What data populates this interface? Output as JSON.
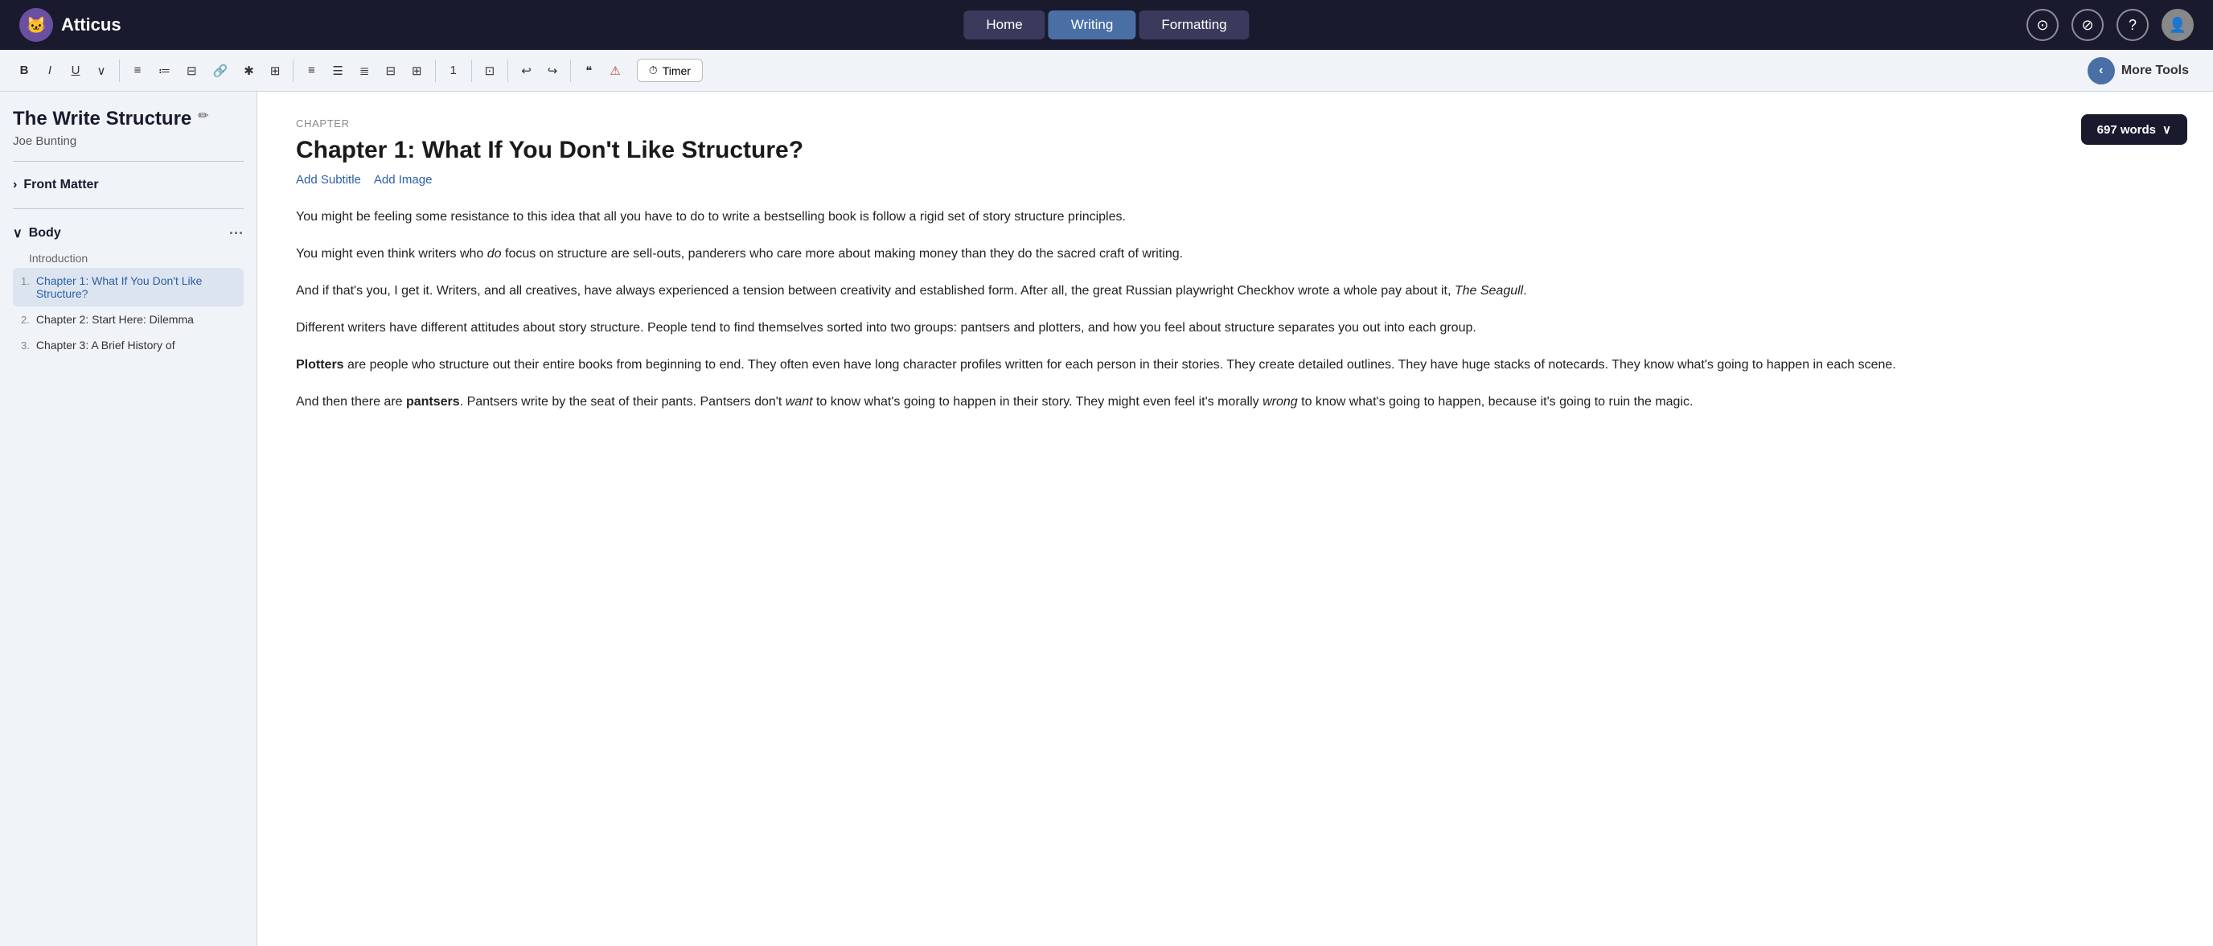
{
  "app": {
    "name": "Atticus",
    "logo_emoji": "🐱"
  },
  "nav": {
    "home_label": "Home",
    "writing_label": "Writing",
    "formatting_label": "Formatting"
  },
  "nav_icons": {
    "export_label": "⊙",
    "save_label": "💾",
    "help_label": "?",
    "avatar_label": "👤"
  },
  "toolbar": {
    "bold": "B",
    "italic": "I",
    "underline": "U",
    "dropdown": "∨",
    "align_left": "≡",
    "bullet_list": "≔",
    "numbered_list": "⊟",
    "link": "🔗",
    "asterisk": "✱",
    "image": "⊞",
    "sep1": "",
    "align_c1": "≡",
    "align_c2": "≡",
    "align_c3": "≡",
    "align_c4": "≡",
    "align_c5": "≡",
    "sep2": "",
    "number_1": "1",
    "sep3": "",
    "expand": "⊡",
    "sep4": "",
    "undo": "↩",
    "redo": "↪",
    "sep5": "",
    "quote": "❝",
    "alert": "⚠",
    "timer_label": "Timer",
    "more_tools_label": "More Tools",
    "chevron_left": "‹"
  },
  "sidebar": {
    "book_title": "The Write Structure",
    "book_author": "Joe Bunting",
    "front_matter_label": "Front Matter",
    "body_label": "Body",
    "intro_label": "Introduction",
    "chapters": [
      {
        "num": "1.",
        "title": "Chapter 1: What If You Don't Like Structure?",
        "active": true
      },
      {
        "num": "2.",
        "title": "Chapter 2: Start Here: Dilemma",
        "active": false
      },
      {
        "num": "3.",
        "title": "Chapter 3: A Brief History of",
        "active": false
      }
    ]
  },
  "editor": {
    "chapter_label": "Chapter",
    "chapter_title": "Chapter 1: What If You Don't Like Structure?",
    "add_subtitle_label": "Add Subtitle",
    "add_image_label": "Add Image",
    "words_count": "697 words",
    "words_chevron": "∨",
    "paragraphs": [
      "You might be feeling some resistance to this idea that all you have to do to write a bestselling book is follow a rigid set of story structure principles.",
      "You might even think writers who {em}do{/em} focus on structure are sell-outs, panderers who care more about making money than they do the sacred craft of writing.",
      "And if that's you, I get it. Writers, and all creatives, have always experienced a tension between creativity and established form. After all, the great Russian playwright Checkhov wrote a whole pay about it, {em}The Seagull{/em}.",
      "Different writers have different attitudes about story structure. People tend to find themselves sorted into two groups: pantsers and plotters, and how you feel about structure separates you out into each group.",
      "{strong}Plotters{/strong} are people who structure out their entire books from beginning to end. They often even have long character profiles written for each person in their stories. They create detailed outlines. They have huge stacks of notecards. They know what's going to happen in each scene.",
      "And then there are {strong}pantsers{/strong}. Pantsers write by the seat of their pants. Pantsers don't {em}want{/em} to know what's going to happen in their story. They might even feel it's morally {em}wrong{/em} to know what's going to happen, because it's going to ruin the magic."
    ]
  }
}
